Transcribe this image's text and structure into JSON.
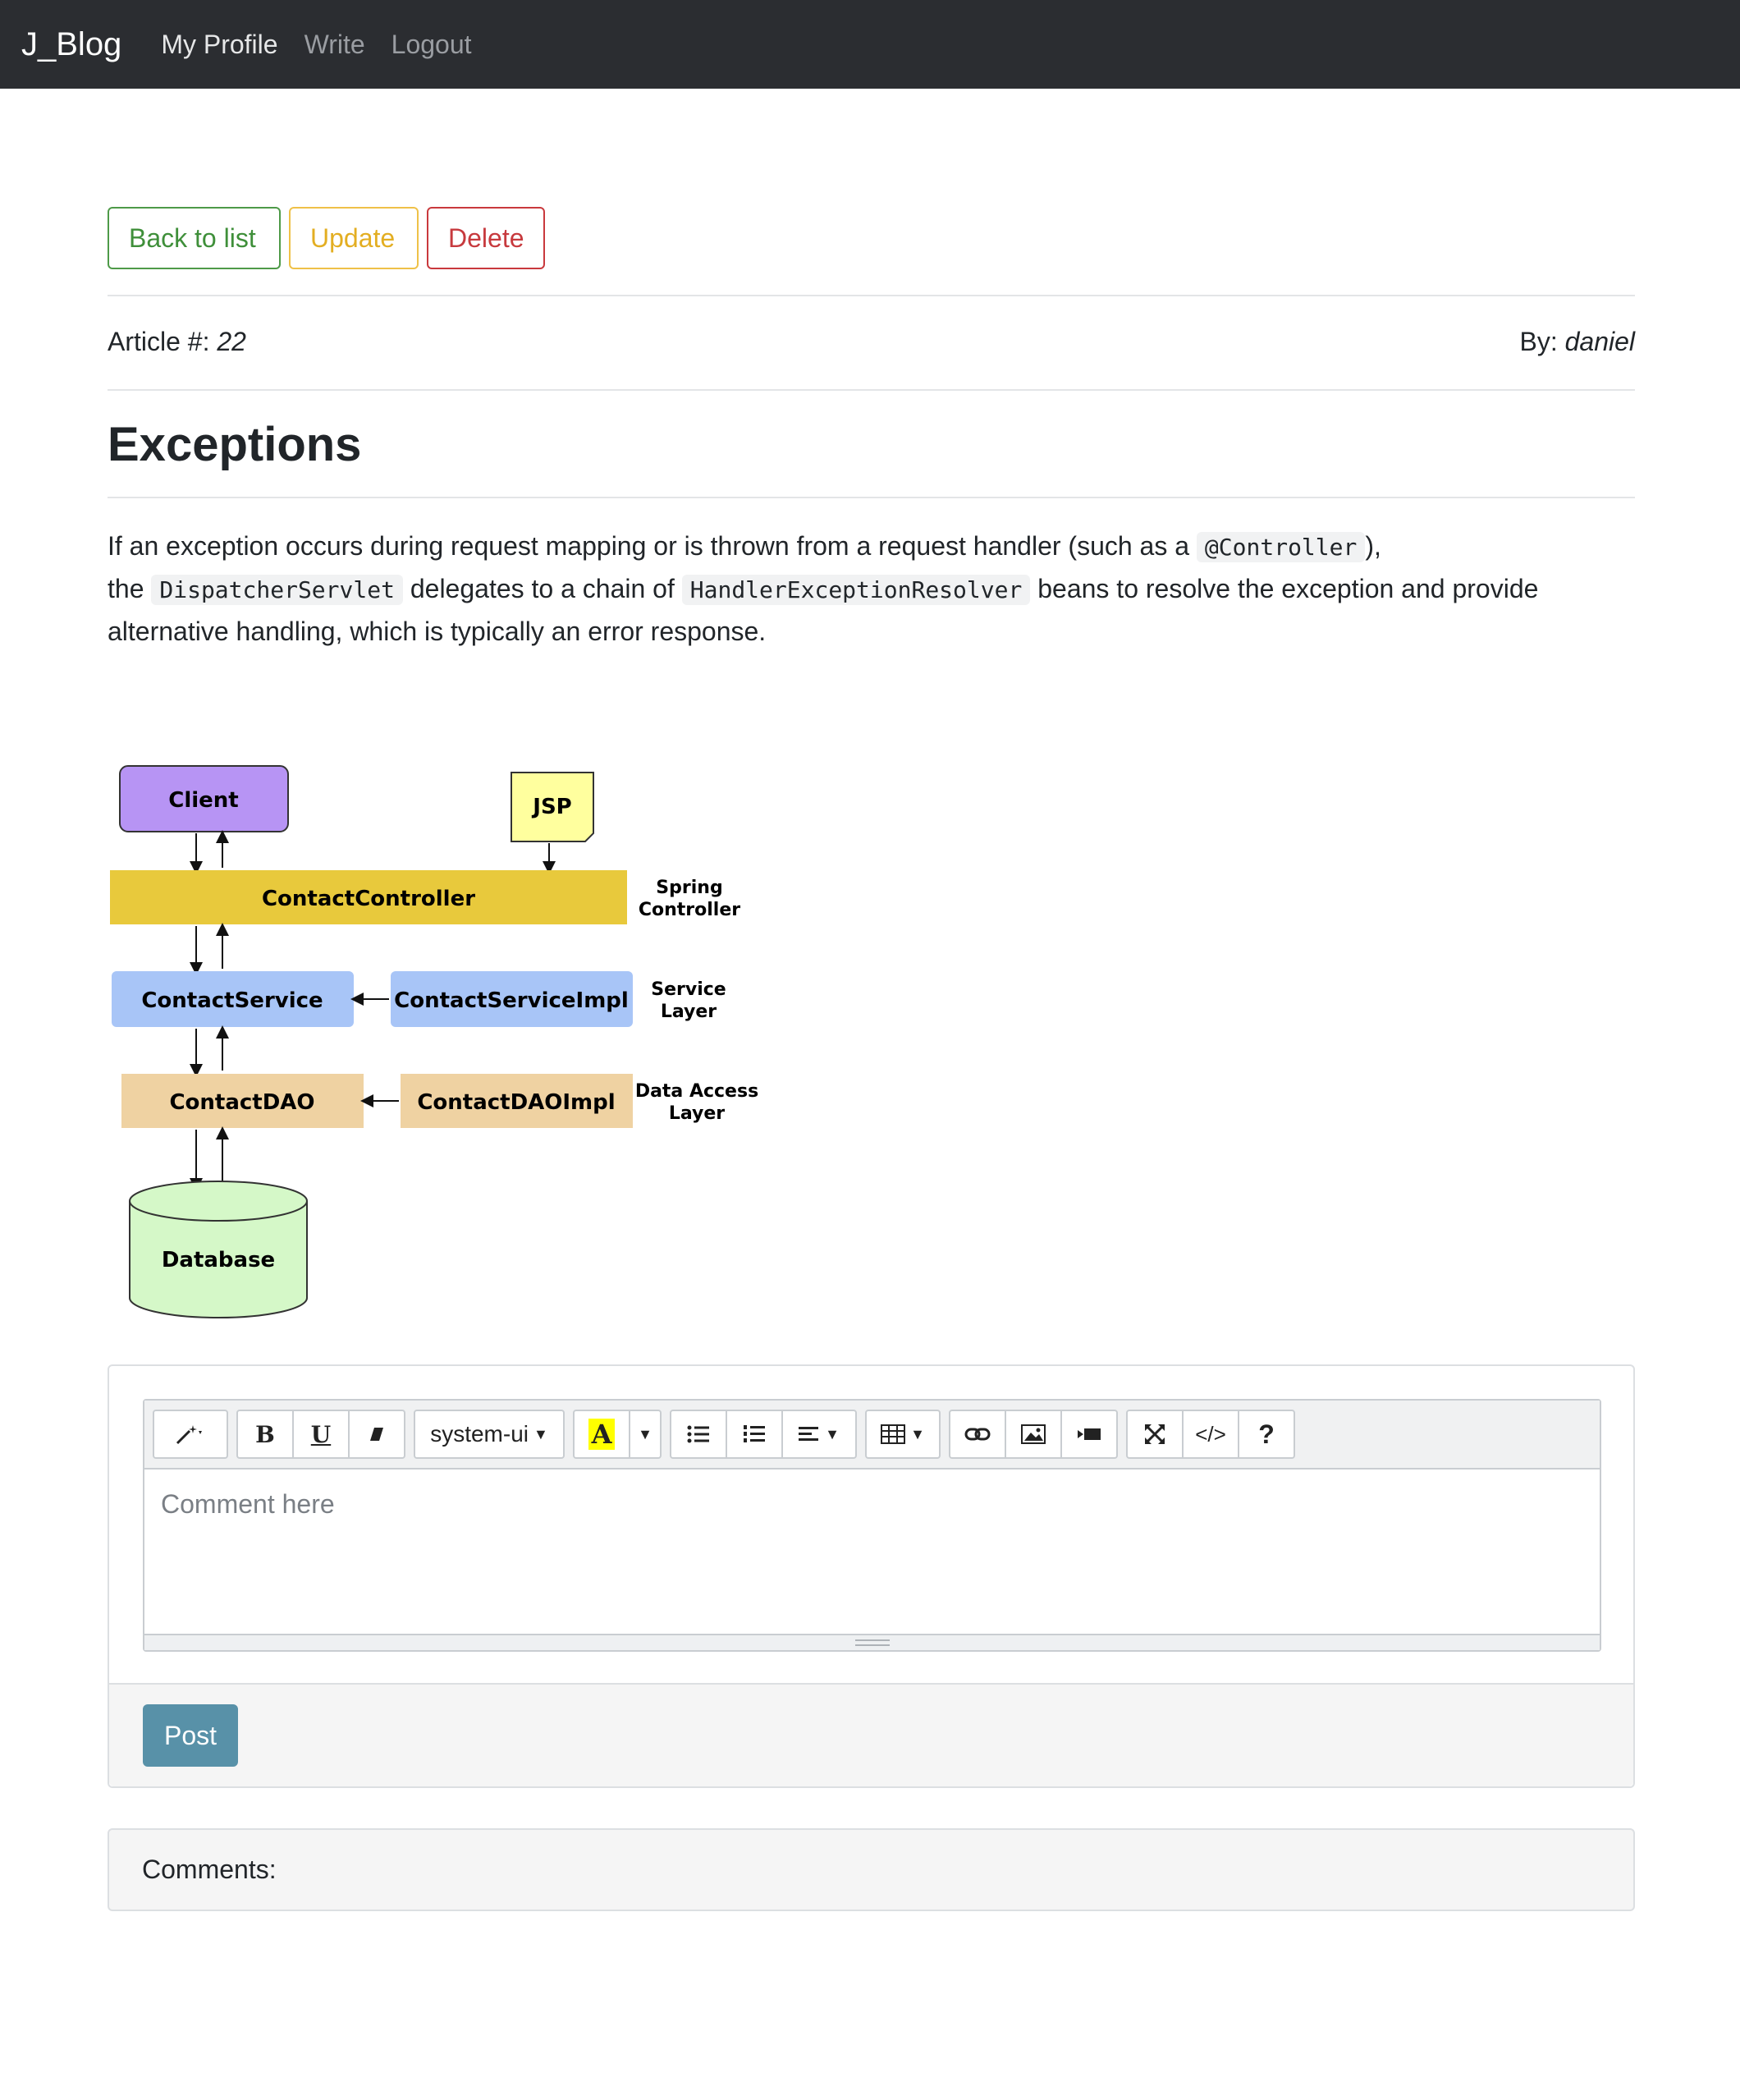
{
  "navbar": {
    "brand": "J_Blog",
    "links": [
      "My Profile",
      "Write",
      "Logout"
    ]
  },
  "actions": {
    "back_label": "Back to list",
    "update_label": "Update",
    "delete_label": "Delete"
  },
  "article": {
    "number_label": "Article #:",
    "number": "22",
    "author_label": "By:",
    "author": "daniel",
    "title": "Exceptions",
    "body": {
      "t1": "If an exception occurs during request mapping or is thrown from a request handler (such as a ",
      "c1": "@Controller",
      "t2": "),",
      "t3": "the ",
      "c2": "DispatcherServlet",
      "t4": " delegates to a chain of ",
      "c3": "HandlerExceptionResolver",
      "t5": " beans to resolve the exception and provide alternative handling, which is typically an error response."
    }
  },
  "diagram": {
    "client": "Client",
    "jsp": "JSP",
    "controller": "ContactController",
    "service": "ContactService",
    "service_impl": "ContactServiceImpl",
    "dao": "ContactDAO",
    "dao_impl": "ContactDAOImpl",
    "database": "Database",
    "layer_spring_1": "Spring",
    "layer_spring_2": "Controller",
    "layer_service_1": "Service",
    "layer_service_2": "Layer",
    "layer_data_1": "Data Access",
    "layer_data_2": "Layer",
    "colors": {
      "client": "#b794f4",
      "jsp": "#ffff9e",
      "controller": "#e8c93c",
      "service": "#a8c5f7",
      "dao": "#efd2a2",
      "database": "#d5f8c8"
    }
  },
  "editor": {
    "font_name": "system-ui",
    "placeholder": "Comment here",
    "icons": [
      "magic-icon",
      "bold-icon",
      "underline-icon",
      "eraser-icon",
      "font-name-select",
      "text-color-icon",
      "unordered-list-icon",
      "ordered-list-icon",
      "align-icon",
      "table-icon",
      "link-icon",
      "picture-icon",
      "video-icon",
      "fullscreen-icon",
      "code-view-icon",
      "help-icon"
    ],
    "bold": "B",
    "underline": "U",
    "color_letter": "A",
    "code_view": "</>",
    "help": "?",
    "post_label": "Post"
  },
  "comments": {
    "label": "Comments:"
  }
}
